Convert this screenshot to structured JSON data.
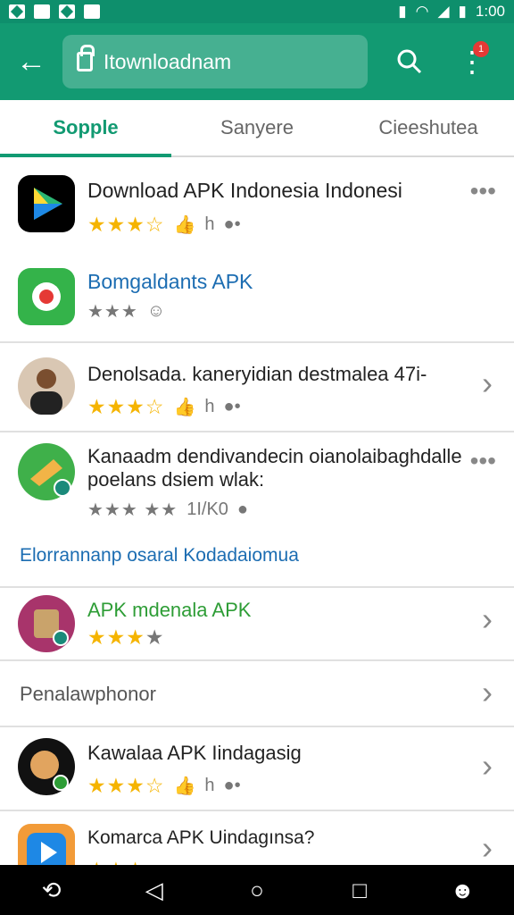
{
  "status": {
    "time": "1:00"
  },
  "appbar": {
    "search_text": "Itownloadnam",
    "back_icon": "arrow-left-icon",
    "search_icon": "search-icon",
    "menu_icon": "more-vert-icon",
    "badge": "1"
  },
  "tabs": [
    "Sopple",
    "Sanyere",
    "Cieeshutea"
  ],
  "items": [
    {
      "title": "Download APK Indonesia Indonesi",
      "meta": "h"
    },
    {
      "title": "Bomgaldants APK"
    },
    {
      "title": "Denolsada. kaneryidian destmalea 47i-",
      "meta": "h"
    },
    {
      "title_line1": "Kanaadm dendivandecin oianolaibaghdalle",
      "title_line2": "poelans dsiem wlak:",
      "meta": "1I/K0"
    }
  ],
  "section_heading": "Elorrannanp osaral Kodadaiomua",
  "items2": [
    {
      "title": "APK mdenala APK"
    },
    {
      "title": "Penalawphonor"
    },
    {
      "title": "Kawalaa APK Iindagasig",
      "meta": "h"
    },
    {
      "title": "Komarca APK Uindagınsa?"
    }
  ],
  "colors": {
    "primary": "#129a72",
    "star": "#f5b400",
    "link": "#1c6db2"
  }
}
